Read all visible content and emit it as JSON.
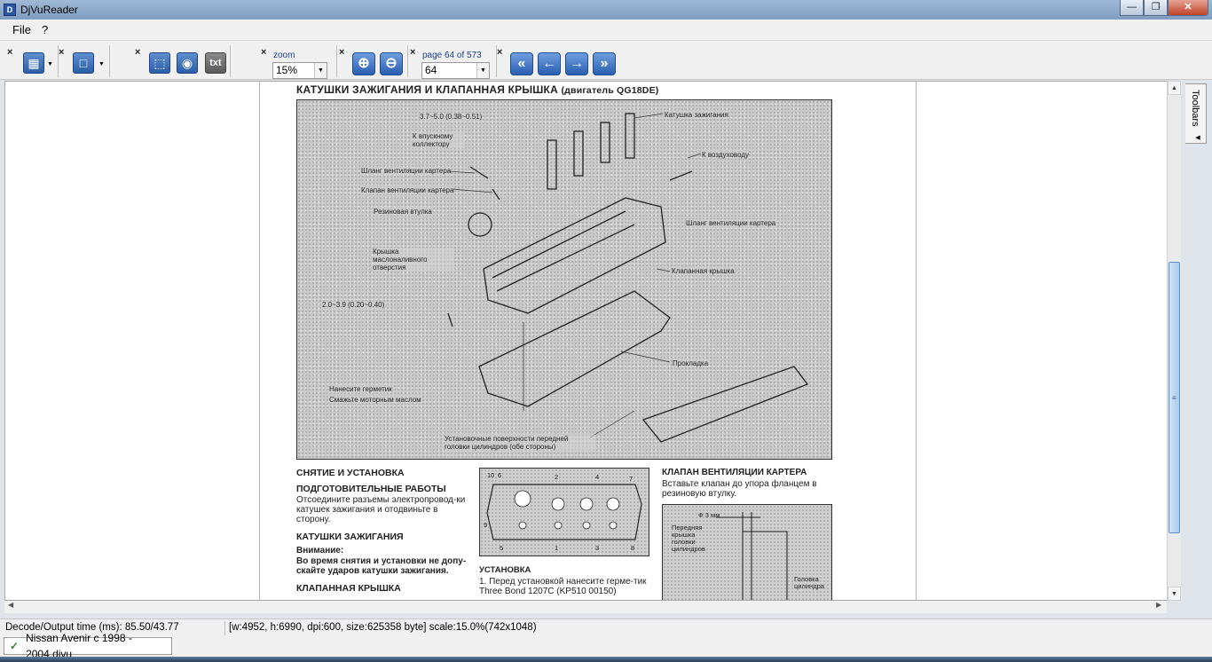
{
  "window": {
    "title": "DjVuReader",
    "icon_name": "djvu-app-icon"
  },
  "menu": {
    "items": [
      "File",
      "?"
    ]
  },
  "toolbar": {
    "zoom_label": "zoom",
    "zoom_value": "15%",
    "page_label": "page 64 of 573",
    "page_value": "64",
    "txt_label": "txt"
  },
  "document": {
    "title": "КАТУШКИ ЗАЖИГАНИЯ И КЛАПАННАЯ КРЫШКА",
    "title_suffix": "(двигатель QG18DE)",
    "figure_labels": [
      "3.7~5.0 (0.38~0.51)",
      "Катушка зажигания",
      "К впускному коллектору",
      "Шланг вентиляции картера",
      "К воздуховоду",
      "Клапан вентиляции картера",
      "Резиновая втулка",
      "Шланг вентиляции картера",
      "Крышка маслоналивного отверстия",
      "Клапанная крышка",
      "2.0~3.9 (0.20~0.40)",
      "Прокладка",
      "Нанесите герметик",
      "Смажьте моторным маслом",
      "Установочные поверхности передней головки цилиндров (обе стороны)"
    ],
    "left_col": {
      "h1": "СНЯТИЕ И УСТАНОВКА",
      "h2": "ПОДГОТОВИТЕЛЬНЫЕ РАБОТЫ",
      "p1": "Отсоедините разъемы электропровод-ки катушек зажигания и отодвиньте в сторону.",
      "h3": "КАТУШКИ ЗАЖИГАНИЯ",
      "warn_title": "Внимание:",
      "warn_text": "Во время снятия и установки не допу-скайте ударов катушки зажигания.",
      "h4": "КЛАПАННАЯ КРЫШКА"
    },
    "mid_col": {
      "fig_numbers": [
        "10",
        "6",
        "2",
        "4",
        "7",
        "9",
        "5",
        "1",
        "3",
        "8"
      ],
      "h1": "УСТАНОВКА",
      "p1": "1.  Перед установкой нанесите герме-тик Three Bond 1207C (KP510 00150)"
    },
    "right_col": {
      "h1": "КЛАПАН ВЕНТИЛЯЦИИ КАРТЕРА",
      "p1": "Вставьте клапан до упора фланцем в резиновую втулку.",
      "fig_labels": [
        "Ф 3 мм",
        "Передняя крышка головки цилиндров",
        "Головка цилиндра"
      ]
    }
  },
  "side_tab": {
    "label": "Toolbars"
  },
  "status": {
    "decode": "Decode/Output time (ms): 85.50/43.77",
    "info": "[w:4952, h:6990, dpi:600, size:625358 byte] scale:15.0%(742x1048)"
  },
  "doc_tab": {
    "label": "Nissan Avenir c 1998 - 2004.djvu"
  }
}
